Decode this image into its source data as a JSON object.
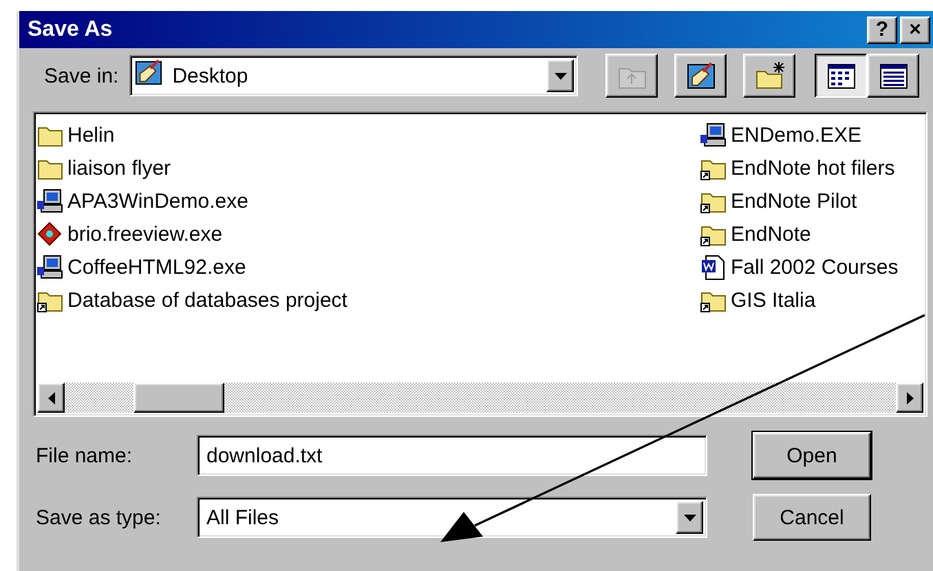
{
  "window": {
    "title": "Save As",
    "title_buttons": [
      "?",
      "×"
    ]
  },
  "save_in": {
    "label": "Save in:",
    "value": "Desktop"
  },
  "toolbar": [
    {
      "kind": "up-folder",
      "disabled": true,
      "selected": false
    },
    {
      "kind": "desktop",
      "disabled": false,
      "selected": false
    },
    {
      "kind": "new-folder",
      "disabled": false,
      "selected": false
    },
    {
      "kind": "list-view",
      "disabled": false,
      "selected": true
    },
    {
      "kind": "details-view",
      "disabled": false,
      "selected": false
    }
  ],
  "files": {
    "columns": [
      [
        {
          "name": "Helin",
          "kind": "folder"
        },
        {
          "name": "liaison flyer",
          "kind": "folder"
        },
        {
          "name": "APA3WinDemo.exe",
          "kind": "computer-app"
        },
        {
          "name": "brio.freeview.exe",
          "kind": "diamond-app"
        },
        {
          "name": "CoffeeHTML92.exe",
          "kind": "computer-app"
        },
        {
          "name": "Database of databases project",
          "kind": "shortcut-folder"
        }
      ],
      [
        {
          "name": "ENDemo.EXE",
          "kind": "computer-app"
        },
        {
          "name": "EndNote hot filers",
          "kind": "shortcut-folder"
        },
        {
          "name": "EndNote Pilot",
          "kind": "shortcut-folder"
        },
        {
          "name": "EndNote",
          "kind": "shortcut-folder"
        },
        {
          "name": "Fall 2002 Courses",
          "kind": "word-doc"
        },
        {
          "name": "GIS Italia",
          "kind": "shortcut-folder"
        }
      ]
    ]
  },
  "file_name": {
    "label": "File name:",
    "value": "download.txt"
  },
  "save_as_type": {
    "label": "Save as type:",
    "value": "All Files"
  },
  "buttons": [
    {
      "label": "Open",
      "default": true
    },
    {
      "label": "Cancel",
      "default": false
    }
  ]
}
